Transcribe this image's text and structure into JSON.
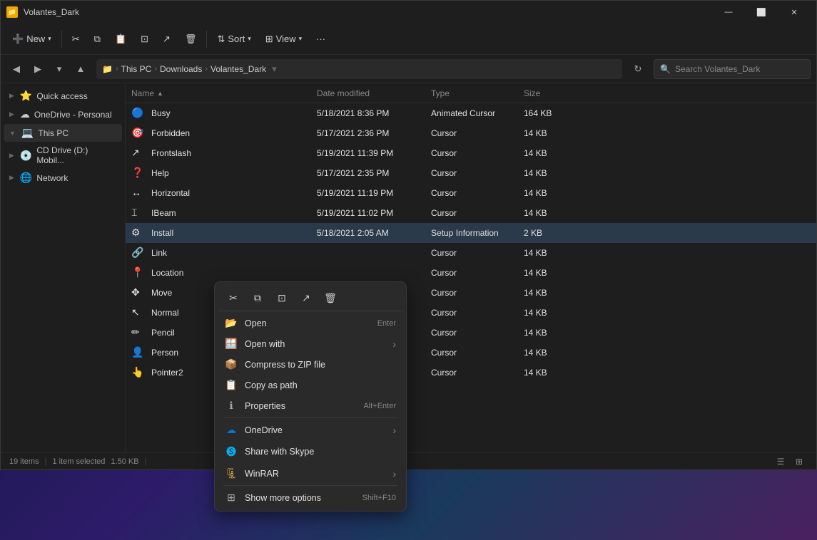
{
  "window": {
    "title": "Volantes_Dark",
    "icon": "📁"
  },
  "toolbar": {
    "new_label": "New",
    "sort_label": "Sort",
    "view_label": "View",
    "more_label": "···"
  },
  "address": {
    "this_pc": "This PC",
    "downloads": "Downloads",
    "folder": "Volantes_Dark",
    "search_placeholder": "Search Volantes_Dark"
  },
  "sidebar": {
    "items": [
      {
        "label": "Quick access",
        "icon": "⭐",
        "expand": "▶"
      },
      {
        "label": "OneDrive - Personal",
        "icon": "☁",
        "expand": "▶"
      },
      {
        "label": "This PC",
        "icon": "💻",
        "expand": "▼",
        "active": true
      },
      {
        "label": "CD Drive (D:) Mobil...",
        "icon": "💿",
        "expand": "▶"
      },
      {
        "label": "Network",
        "icon": "🌐",
        "expand": "▶"
      }
    ]
  },
  "file_header": {
    "name": "Name",
    "date_modified": "Date modified",
    "type": "Type",
    "size": "Size"
  },
  "files": [
    {
      "name": "Busy",
      "date": "5/18/2021 8:36 PM",
      "type": "Animated Cursor",
      "size": "164 KB",
      "icon": "🔵",
      "selected": false
    },
    {
      "name": "Forbidden",
      "date": "5/17/2021 2:36 PM",
      "type": "Cursor",
      "size": "14 KB",
      "icon": "🎯",
      "selected": false
    },
    {
      "name": "Frontslash",
      "date": "5/19/2021 11:39 PM",
      "type": "Cursor",
      "size": "14 KB",
      "icon": "↗",
      "selected": false
    },
    {
      "name": "Help",
      "date": "5/17/2021 2:35 PM",
      "type": "Cursor",
      "size": "14 KB",
      "icon": "❓",
      "selected": false
    },
    {
      "name": "Horizontal",
      "date": "5/19/2021 11:19 PM",
      "type": "Cursor",
      "size": "14 KB",
      "icon": "↔",
      "selected": false
    },
    {
      "name": "IBeam",
      "date": "5/19/2021 11:02 PM",
      "type": "Cursor",
      "size": "14 KB",
      "icon": "⌶",
      "selected": false
    },
    {
      "name": "Install",
      "date": "5/18/2021 2:05 AM",
      "type": "Setup Information",
      "size": "2 KB",
      "icon": "⚙",
      "selected": true
    },
    {
      "name": "Link",
      "date": "",
      "type": "Cursor",
      "size": "14 KB",
      "icon": "🔗",
      "selected": false
    },
    {
      "name": "Location",
      "date": "",
      "type": "Cursor",
      "size": "14 KB",
      "icon": "📍",
      "selected": false
    },
    {
      "name": "Move",
      "date": "",
      "type": "Cursor",
      "size": "14 KB",
      "icon": "✥",
      "selected": false
    },
    {
      "name": "Normal",
      "date": "",
      "type": "Cursor",
      "size": "14 KB",
      "icon": "↖",
      "selected": false
    },
    {
      "name": "Pencil",
      "date": "",
      "type": "Cursor",
      "size": "14 KB",
      "icon": "✏",
      "selected": false
    },
    {
      "name": "Person",
      "date": "",
      "type": "Cursor",
      "size": "14 KB",
      "icon": "👤",
      "selected": false
    },
    {
      "name": "Pointer2",
      "date": "",
      "type": "Cursor",
      "size": "14 KB",
      "icon": "👆",
      "selected": false
    }
  ],
  "context_menu": {
    "toolbar": {
      "cut": "✂",
      "copy": "⧉",
      "copy2": "⊡",
      "share": "↗",
      "delete": "🗑"
    },
    "items": [
      {
        "label": "Open",
        "icon": "📂",
        "shortcut": "Enter",
        "has_arrow": false,
        "separator_after": false
      },
      {
        "label": "Open with",
        "icon": "🪟",
        "shortcut": "",
        "has_arrow": true,
        "separator_after": false
      },
      {
        "label": "Compress to ZIP file",
        "icon": "📦",
        "shortcut": "",
        "has_arrow": false,
        "separator_after": false
      },
      {
        "label": "Copy as path",
        "icon": "📋",
        "shortcut": "",
        "has_arrow": false,
        "separator_after": false
      },
      {
        "label": "Properties",
        "icon": "ℹ",
        "shortcut": "Alt+Enter",
        "has_arrow": false,
        "separator_after": true
      },
      {
        "label": "OneDrive",
        "icon": "☁",
        "shortcut": "",
        "has_arrow": true,
        "separator_after": false
      },
      {
        "label": "Share with Skype",
        "icon": "🅢",
        "shortcut": "",
        "has_arrow": false,
        "separator_after": false
      },
      {
        "label": "WinRAR",
        "icon": "🗜",
        "shortcut": "",
        "has_arrow": true,
        "separator_after": true
      },
      {
        "label": "Show more options",
        "icon": "⊞",
        "shortcut": "Shift+F10",
        "has_arrow": false,
        "separator_after": false
      }
    ]
  },
  "status_bar": {
    "items_count": "19 items",
    "selected": "1 item selected",
    "size": "1.50 KB"
  }
}
